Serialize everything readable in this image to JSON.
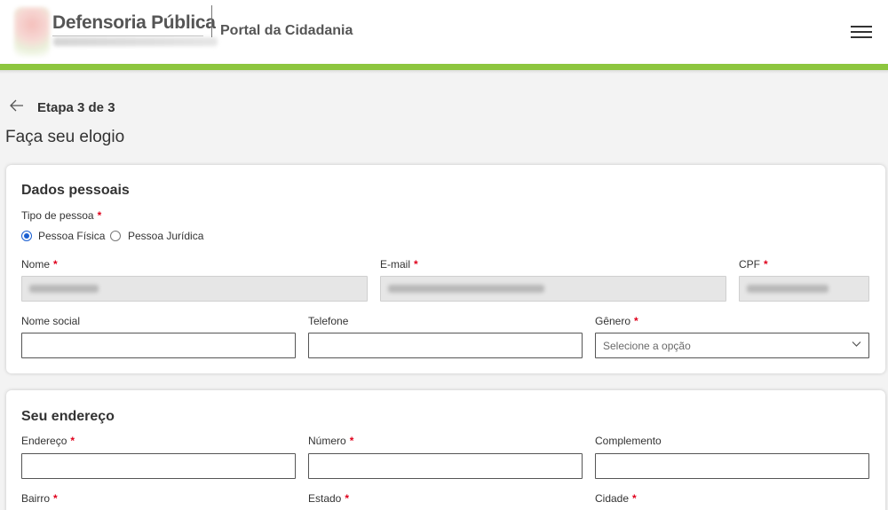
{
  "header": {
    "org_name": "Defensoria Pública",
    "portal_title": "Portal da Cidadania",
    "menu_icon": "hamburger-menu-icon"
  },
  "nav": {
    "back_icon": "arrow-left-icon",
    "step_label": "Etapa 3 de 3"
  },
  "page": {
    "title": "Faça seu elogio"
  },
  "personal": {
    "title": "Dados pessoais",
    "person_type": {
      "label": "Tipo de pessoa",
      "required": "*",
      "options": [
        "Pessoa Física",
        "Pessoa Jurídica"
      ],
      "selected": "Pessoa Física"
    },
    "nome": {
      "label": "Nome",
      "required": "*"
    },
    "email": {
      "label": "E-mail",
      "required": "*"
    },
    "cpf": {
      "label": "CPF",
      "required": "*"
    },
    "nome_social": {
      "label": "Nome social",
      "value": ""
    },
    "telefone": {
      "label": "Telefone",
      "value": ""
    },
    "genero": {
      "label": "Gênero",
      "required": "*",
      "placeholder": "Selecione a opção"
    }
  },
  "address": {
    "title": "Seu endereço",
    "endereco": {
      "label": "Endereço",
      "required": "*",
      "value": ""
    },
    "numero": {
      "label": "Número",
      "required": "*",
      "value": ""
    },
    "complemento": {
      "label": "Complemento",
      "value": ""
    },
    "bairro": {
      "label": "Bairro",
      "required": "*"
    },
    "estado": {
      "label": "Estado",
      "required": "*"
    },
    "cidade": {
      "label": "Cidade",
      "required": "*"
    }
  },
  "colors": {
    "accent_green": "#8dc63f",
    "required_red": "#e0001b",
    "radio_blue": "#1a5fd1"
  }
}
